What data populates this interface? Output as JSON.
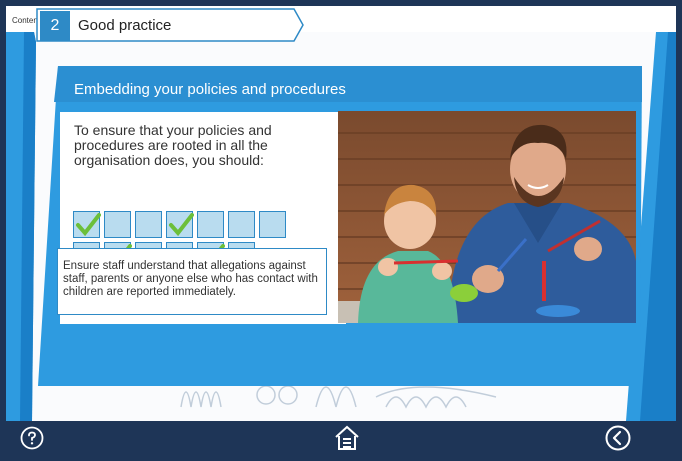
{
  "header": {
    "contents_label": "Contents"
  },
  "section": {
    "number": "2",
    "title": "Good practice"
  },
  "card": {
    "heading": "Embedding your policies and procedures",
    "intro": "To ensure that your policies and procedures are rooted in all the organisation does, you should:",
    "checklist": {
      "row1": [
        true,
        false,
        false,
        true,
        false,
        false,
        false
      ],
      "row2": [
        false,
        true,
        false,
        false,
        true,
        false
      ]
    },
    "answer": "Ensure staff understand that allegations against staff, parents or anyone else who has contact with children are reported immediately."
  },
  "footer": {
    "help_icon": "question-circle-icon",
    "home_icon": "home-icon",
    "back_icon": "chevron-left-circle-icon"
  },
  "colors": {
    "navy": "#1e3557",
    "accent": "#2e8ac6",
    "check": "#6cbf3a",
    "box_fill": "#b9dcef"
  }
}
